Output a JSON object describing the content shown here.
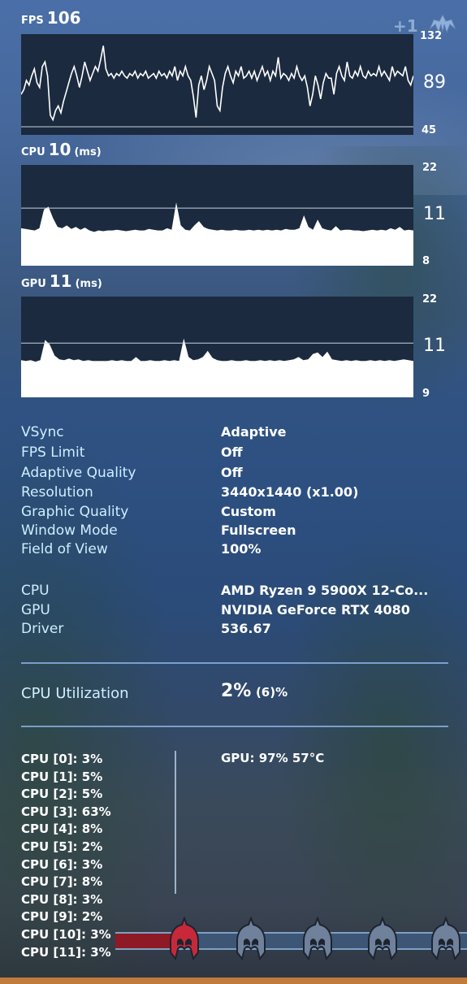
{
  "overlay": {
    "badge": "+1",
    "icons": [
      "trident-icon"
    ]
  },
  "fps": {
    "label": "FPS",
    "value": "106",
    "axis": {
      "max": "132",
      "mid": "89",
      "min": "45"
    }
  },
  "cpu_time": {
    "label": "CPU",
    "value": "10",
    "unit": "(ms)",
    "axis": {
      "max": "22",
      "mid": "11",
      "min": "8"
    }
  },
  "gpu_time": {
    "label": "GPU",
    "value": "11",
    "unit": "(ms)",
    "axis": {
      "max": "22",
      "mid": "11",
      "min": "9"
    }
  },
  "settings": [
    {
      "key": "VSync",
      "value": "Adaptive"
    },
    {
      "key": "FPS Limit",
      "value": "Off"
    },
    {
      "key": "Adaptive Quality",
      "value": "Off"
    },
    {
      "key": "Resolution",
      "value": "3440x1440 (x1.00)"
    },
    {
      "key": "Graphic Quality",
      "value": "Custom"
    },
    {
      "key": "Window Mode",
      "value": "Fullscreen"
    },
    {
      "key": "Field of View",
      "value": "100%"
    }
  ],
  "hardware": [
    {
      "key": "CPU",
      "value": "AMD Ryzen 9 5900X 12-Co..."
    },
    {
      "key": "GPU",
      "value": "NVIDIA GeForce RTX 4080"
    },
    {
      "key": "Driver",
      "value": "536.67"
    }
  ],
  "utilization": {
    "label": "CPU Utilization",
    "value": "2%",
    "secondary": "(6)%"
  },
  "cores": [
    "CPU [0]: 3%",
    "CPU [1]: 5%",
    "CPU [2]: 5%",
    "CPU [3]: 63%",
    "CPU [4]: 8%",
    "CPU [5]: 2%",
    "CPU [6]: 3%",
    "CPU [7]: 8%",
    "CPU [8]: 3%",
    "CPU [9]: 2%",
    "CPU [10]: 3%",
    "CPU [11]: 3%"
  ],
  "gpu_status": "GPU: 97% 57°C",
  "hud": {
    "progress_fraction": 0.18,
    "helmets": [
      {
        "state": "active",
        "color": "#c8293a"
      },
      {
        "state": "inactive",
        "color": "#6f819b"
      },
      {
        "state": "inactive",
        "color": "#6f819b"
      },
      {
        "state": "inactive",
        "color": "#6f819b"
      },
      {
        "state": "inactive",
        "color": "#6f819b"
      }
    ]
  },
  "chart_data": [
    {
      "type": "line",
      "title": "FPS 106",
      "ylim": [
        45,
        132
      ],
      "yticks": [
        "132",
        "89",
        "45"
      ],
      "reference_line": 52,
      "series": [
        {
          "name": "FPS",
          "values": [
            80,
            84,
            92,
            88,
            96,
            102,
            90,
            86,
            104,
            108,
            96,
            62,
            58,
            66,
            70,
            64,
            74,
            82,
            90,
            98,
            104,
            96,
            86,
            96,
            108,
            100,
            92,
            98,
            104,
            100,
            110,
            122,
            102,
            96,
            98,
            94,
            98,
            96,
            100,
            96,
            94,
            98,
            96,
            100,
            94,
            98,
            96,
            100,
            94,
            96,
            98,
            94,
            100,
            96,
            98,
            94,
            100,
            96,
            104,
            92,
            100,
            96,
            104,
            96,
            92,
            78,
            60,
            88,
            96,
            84,
            92,
            104,
            98,
            92,
            70,
            66,
            86,
            98,
            104,
            96,
            90,
            100,
            96,
            104,
            94,
            96,
            100,
            94,
            100,
            92,
            98,
            104,
            96,
            100,
            92,
            100,
            96,
            112,
            94,
            98,
            96,
            92,
            98,
            94,
            104,
            96,
            92,
            96,
            86,
            70,
            80,
            96,
            88,
            76,
            90,
            98,
            94,
            94,
            80,
            98,
            104,
            96,
            92,
            108,
            96,
            94,
            100,
            96,
            104,
            96,
            94,
            100,
            96,
            98,
            96,
            104,
            96,
            100,
            96,
            92,
            104,
            96,
            100,
            98,
            96,
            104,
            92,
            88,
            96
          ]
        }
      ],
      "xlabel": "",
      "ylabel": ""
    },
    {
      "type": "area",
      "title": "CPU 10 (ms)",
      "ylim": [
        8,
        22
      ],
      "yticks": [
        "22",
        "11",
        "8"
      ],
      "reference_line": 16,
      "series": [
        {
          "name": "CPU frame time",
          "values": [
            13.2,
            13.1,
            13.0,
            12.9,
            13.2,
            15.8,
            16.2,
            14.6,
            13.4,
            13.2,
            13.6,
            13.1,
            13.4,
            13.0,
            13.3,
            12.9,
            12.7,
            12.9,
            12.8,
            12.9,
            12.9,
            13.0,
            12.9,
            12.8,
            12.9,
            13.0,
            12.9,
            12.9,
            13.1,
            13.0,
            12.9,
            12.9,
            13.2,
            13.0,
            16.8,
            13.6,
            13.0,
            12.9,
            13.6,
            14.2,
            13.4,
            13.1,
            13.0,
            12.9,
            13.0,
            12.9,
            12.9,
            13.0,
            12.9,
            12.9,
            13.0,
            12.9,
            13.0,
            12.9,
            13.0,
            12.9,
            13.0,
            12.9,
            13.1,
            13.0,
            13.0,
            13.2,
            15.0,
            13.4,
            13.0,
            14.4,
            13.2,
            13.0,
            12.9,
            13.5,
            12.9,
            13.0,
            13.0,
            12.9,
            12.9,
            12.8,
            12.9,
            13.0,
            12.9,
            13.0,
            12.9,
            13.2,
            13.0,
            13.4,
            12.9,
            13.0,
            12.9
          ]
        }
      ],
      "xlabel": "",
      "ylabel": ""
    },
    {
      "type": "area",
      "title": "GPU 11 (ms)",
      "ylim": [
        9,
        22
      ],
      "yticks": [
        "22",
        "11",
        "9"
      ],
      "reference_line": 16,
      "series": [
        {
          "name": "GPU frame time",
          "values": [
            13.8,
            13.7,
            13.8,
            13.6,
            13.8,
            16.4,
            15.8,
            14.4,
            13.9,
            13.8,
            14.0,
            13.8,
            13.9,
            13.7,
            13.8,
            13.7,
            13.7,
            13.7,
            13.7,
            13.8,
            13.7,
            13.8,
            13.7,
            13.7,
            14.2,
            13.7,
            13.7,
            13.8,
            13.7,
            13.7,
            13.8,
            13.7,
            13.8,
            13.7,
            16.6,
            14.2,
            13.8,
            13.9,
            14.2,
            15.0,
            14.1,
            13.8,
            13.7,
            13.7,
            13.8,
            13.7,
            13.7,
            13.8,
            13.7,
            13.7,
            13.8,
            13.7,
            13.8,
            13.7,
            13.8,
            13.7,
            13.8,
            13.9,
            14.2,
            13.8,
            13.9,
            14.6,
            14.8,
            14.2,
            14.9,
            13.9,
            13.8,
            13.7,
            13.8,
            13.7,
            13.8,
            13.7,
            13.7,
            13.8,
            13.7,
            13.8,
            13.7,
            13.8,
            13.7,
            13.8,
            13.9,
            13.8,
            13.7
          ]
        }
      ],
      "xlabel": "",
      "ylabel": ""
    }
  ]
}
